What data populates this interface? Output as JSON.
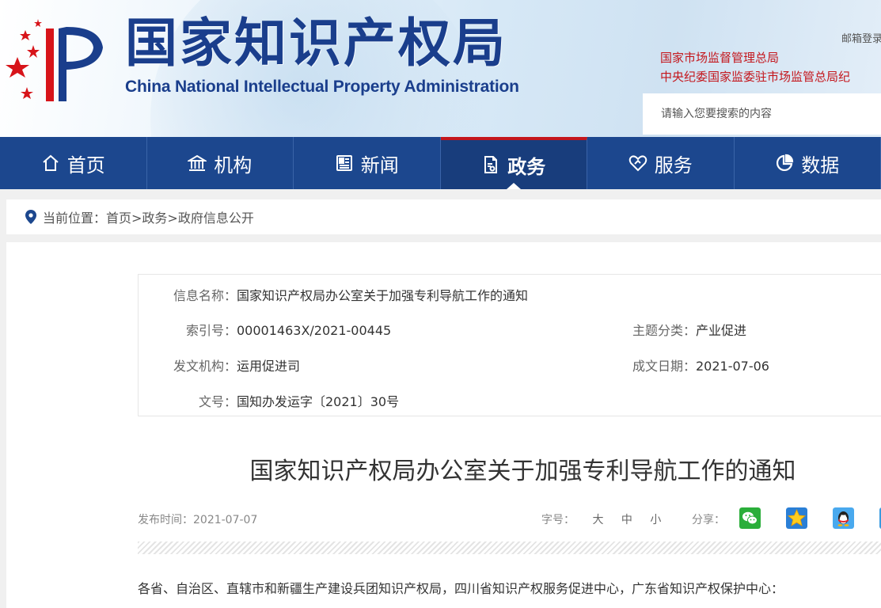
{
  "header": {
    "logo_cn": "国家知识产权局",
    "logo_en": "China National Intellectual Property Administration",
    "login_text": "邮箱登录",
    "org_line1": "国家市场监督管理总局",
    "org_line2": "中央纪委国家监委驻市场监管总局纪",
    "search_placeholder": "请输入您要搜索的内容"
  },
  "nav": {
    "items": [
      {
        "label": "首页",
        "icon": "home-icon"
      },
      {
        "label": "机构",
        "icon": "institution-icon"
      },
      {
        "label": "新闻",
        "icon": "news-icon"
      },
      {
        "label": "政务",
        "icon": "government-affairs-icon",
        "active": true
      },
      {
        "label": "服务",
        "icon": "service-icon"
      },
      {
        "label": "数据",
        "icon": "data-chart-icon"
      }
    ]
  },
  "breadcrumb": {
    "prefix": "当前位置：",
    "path": "首页>政务>政府信息公开"
  },
  "info": {
    "name_label": "信息名称：",
    "name_value": "国家知识产权局办公室关于加强专利导航工作的通知",
    "index_label": "索引号：",
    "index_value": "00001463X/2021-00445",
    "topic_label": "主题分类：",
    "topic_value": "产业促进",
    "issuer_label": "发文机构：",
    "issuer_value": "运用促进司",
    "date_label": "成文日期：",
    "date_value": "2021-07-06",
    "docno_label": "文号：",
    "docno_value": "国知办发运字〔2021〕30号"
  },
  "article": {
    "title": "国家知识产权局办公室关于加强专利导航工作的通知",
    "publish": "发布时间：2021-07-07",
    "font_label": "字号：",
    "font_large": "大",
    "font_medium": "中",
    "font_small": "小",
    "share_label": "分享：",
    "salutation": "各省、自治区、直辖市和新疆生产建设兵团知识产权局，四川省知识产权服务促进中心，广东省知识产权保护中心："
  },
  "colors": {
    "nav_bg": "#1c478e",
    "brand_blue": "#1a3e8c",
    "accent_red": "#c4161c"
  }
}
